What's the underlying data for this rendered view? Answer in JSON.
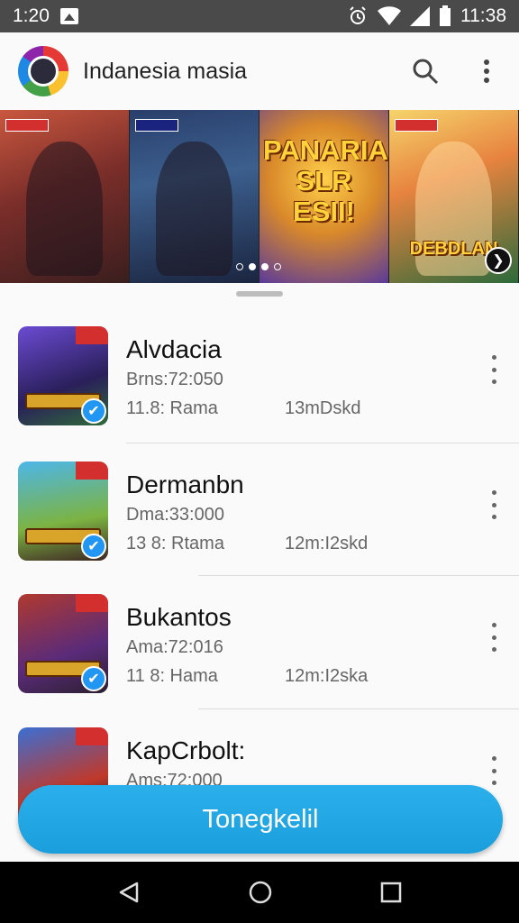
{
  "status_bar": {
    "time_left": "1:20",
    "time_right": "11:38"
  },
  "app_bar": {
    "title": "Indanesia masia"
  },
  "banner": {
    "tiles": [
      {
        "art_text": ""
      },
      {
        "art_text": ""
      },
      {
        "art_text": "PANARIAN SLR ESII!"
      },
      {
        "art_text": "DEBDLAN"
      }
    ],
    "page_count": 4,
    "active_page": 2
  },
  "games": [
    {
      "name": "Alvdacia",
      "meta_line1": "Brns:72:050",
      "meta_left": "11.8: Rama",
      "meta_right": "13mDskd"
    },
    {
      "name": "Dermanbn",
      "meta_line1": "Dma:33:000",
      "meta_left": "13 8: Rtama",
      "meta_right": "12m:I2skd"
    },
    {
      "name": "Bukantos",
      "meta_line1": "Ama:72:016",
      "meta_left": "11 8: Hama",
      "meta_right": "12m:I2ska"
    },
    {
      "name": "KapCrbolt:",
      "meta_line1": "Ams:72:000",
      "meta_left": "",
      "meta_right": ""
    }
  ],
  "cta": {
    "label": "Tonegkelil"
  },
  "colors": {
    "accent": "#1fa6e4",
    "status_bar": "#4a4a4a",
    "nav_bar": "#000000"
  }
}
